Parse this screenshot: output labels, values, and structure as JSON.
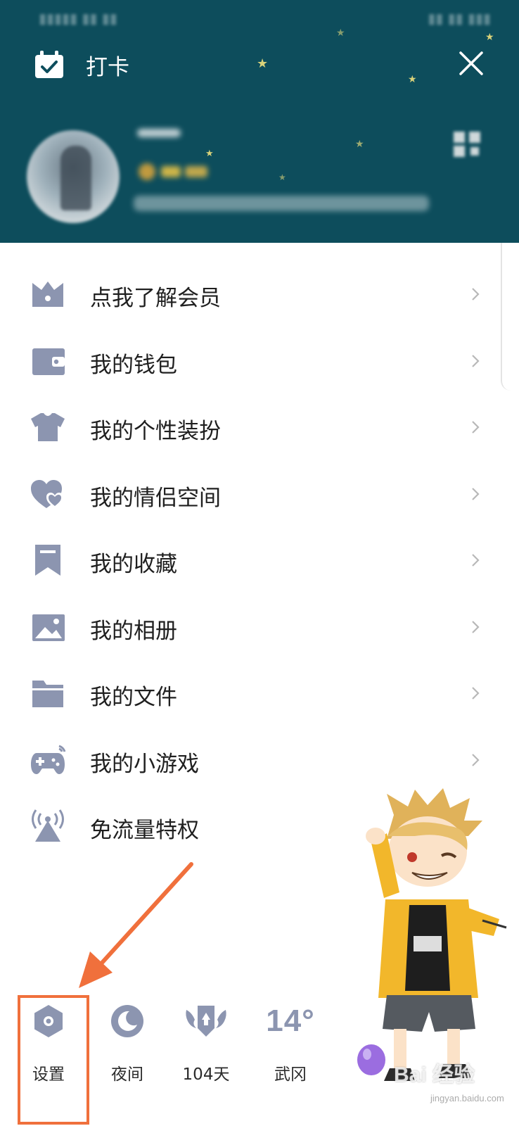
{
  "header": {
    "checkin_label": "打卡",
    "icons": {
      "checkin": "calendar-check-icon",
      "close": "close-icon",
      "qr": "qr-code-icon"
    },
    "background_color": "#0d4d5c"
  },
  "menu": {
    "items": [
      {
        "label": "点我了解会员",
        "icon": "crown-icon"
      },
      {
        "label": "我的钱包",
        "icon": "wallet-icon"
      },
      {
        "label": "我的个性装扮",
        "icon": "tshirt-icon"
      },
      {
        "label": "我的情侣空间",
        "icon": "hearts-icon"
      },
      {
        "label": "我的收藏",
        "icon": "bookmark-icon"
      },
      {
        "label": "我的相册",
        "icon": "image-icon"
      },
      {
        "label": "我的文件",
        "icon": "folder-icon"
      },
      {
        "label": "我的小游戏",
        "icon": "gamepad-icon"
      },
      {
        "label": "免流量特权",
        "icon": "signal-tower-icon"
      }
    ],
    "icon_color": "#8c95b0"
  },
  "bottom_bar": {
    "settings_label": "设置",
    "night_label": "夜间",
    "days_label": "104天",
    "weather_temp": "14°",
    "weather_city": "武冈"
  },
  "annotation": {
    "color": "#f0703c",
    "target": "settings-button"
  },
  "watermark": {
    "text": "Bai 经验",
    "sub": "jingyan.baidu.com"
  }
}
